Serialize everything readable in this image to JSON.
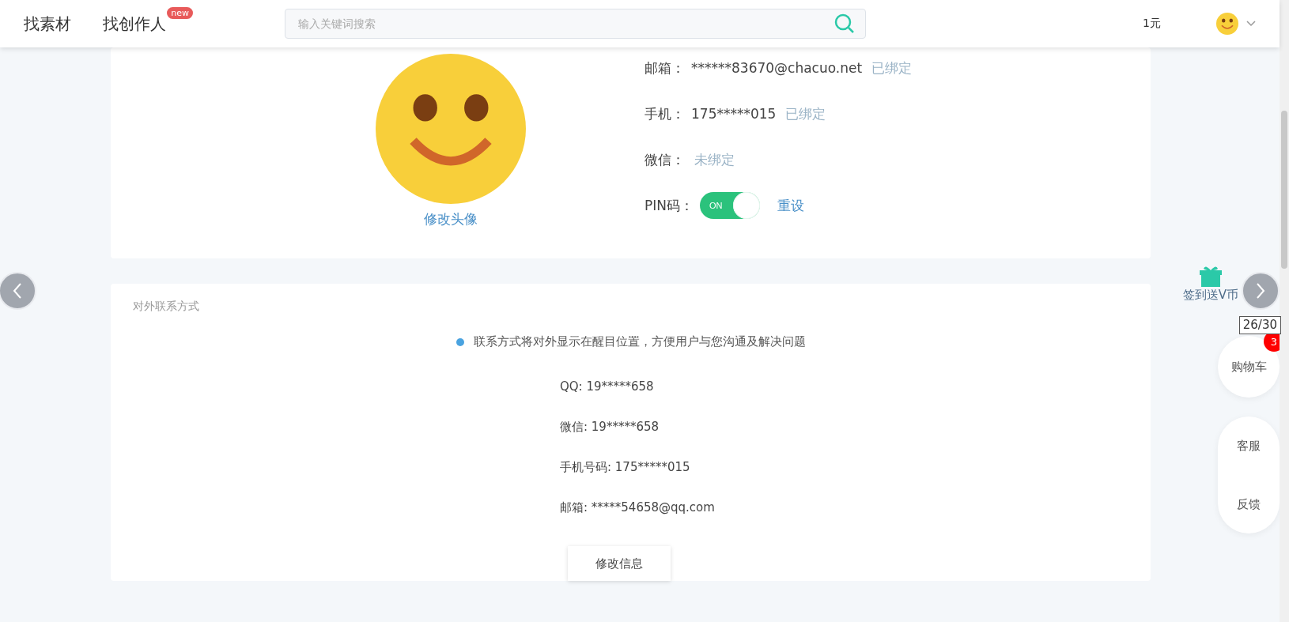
{
  "header": {
    "nav": [
      {
        "label": "找素材"
      },
      {
        "label": "找创作人",
        "badge": "new"
      }
    ],
    "search": {
      "placeholder": "输入关键词搜索"
    },
    "balance": "1元"
  },
  "profile": {
    "avatar_link": "修改头像",
    "rows": [
      {
        "kind": "binding",
        "label": "邮箱：",
        "value": "******83670@chacuo.net",
        "status": "已绑定"
      },
      {
        "kind": "binding",
        "label": "手机：",
        "value": "175*****015",
        "status": "已绑定"
      },
      {
        "kind": "binding",
        "label": "微信：",
        "status": "未绑定"
      },
      {
        "kind": "switch",
        "label": "PIN码：",
        "toggle": {
          "label": "ON",
          "on": true
        },
        "link": "重设"
      }
    ]
  },
  "contact": {
    "title": "对外联系方式",
    "notice": "联系方式将对外显示在醒目位置，方便用户与您沟通及解决问题",
    "items": [
      "QQ: 19*****658",
      "微信: 19*****658",
      "手机号码: 175*****015",
      "邮箱: *****54658@qq.com"
    ],
    "button": "修改信息"
  },
  "viewer": {
    "counter": "26/30"
  },
  "float": {
    "checkin": "签到送V币",
    "cart": {
      "label": "购物车",
      "badge": "3"
    },
    "service": "客服",
    "feedback": "反馈"
  }
}
